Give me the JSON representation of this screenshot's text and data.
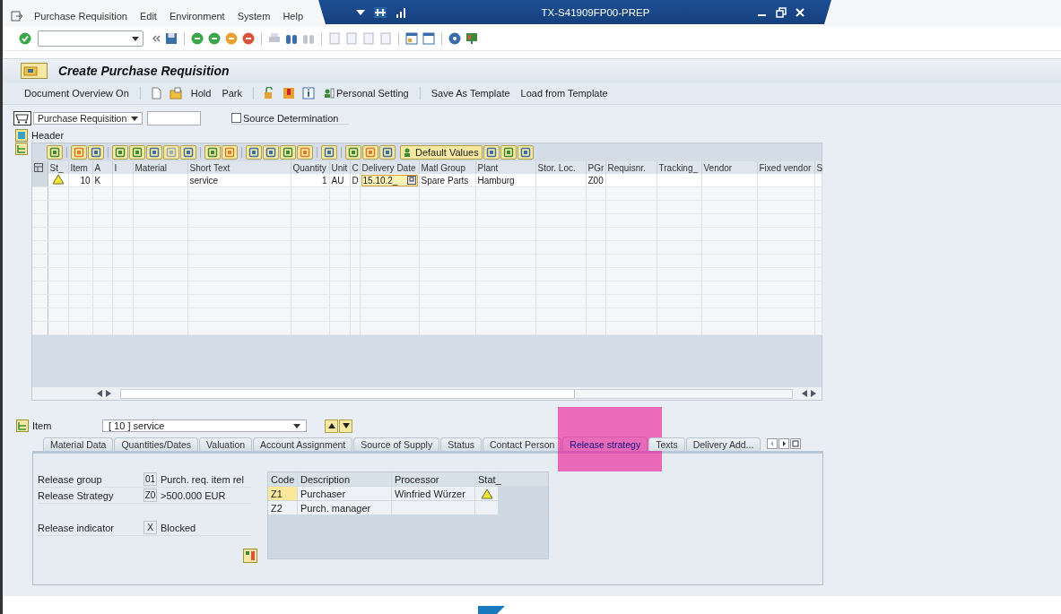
{
  "window": {
    "title": "TX-S41909FP00-PREP"
  },
  "menu": [
    "Purchase Requisition",
    "Edit",
    "Environment",
    "System",
    "Help"
  ],
  "screen_title": "Create Purchase Requisition",
  "app_toolbar": [
    "Document Overview On",
    "Hold",
    "Park",
    "Personal Setting",
    "Save As Template",
    "Load from Template"
  ],
  "document": {
    "type": "Purchase Requisition",
    "source_determination": {
      "label": "Source Determination",
      "checked": false
    }
  },
  "header_label": "Header",
  "grid": {
    "default_values_label": "Default Values",
    "columns": [
      "St_",
      "Item",
      "A",
      "I",
      "Material",
      "Short Text",
      "Quantity",
      "Unit",
      "C",
      "Delivery Date",
      "Matl Group",
      "Plant",
      "Stor. Loc.",
      "PGr",
      "Requisnr.",
      "Tracking_",
      "Vendor",
      "Fixed vendor",
      "S"
    ],
    "rows": [
      {
        "warning": true,
        "cells": [
          null,
          "10",
          "K",
          null,
          null,
          "service",
          "1",
          "AU",
          "D",
          "15.10.2_",
          "Spare Parts",
          "Hamburg",
          null,
          "Z00",
          null,
          null,
          null,
          null,
          null
        ]
      }
    ]
  },
  "item": {
    "label": "Item",
    "value": "[ 10 ] service"
  },
  "tabs": [
    {
      "label": "Material Data",
      "selected": false
    },
    {
      "label": "Quantities/Dates",
      "selected": false
    },
    {
      "label": "Valuation",
      "selected": false
    },
    {
      "label": "Account Assignment",
      "selected": false
    },
    {
      "label": "Source of Supply",
      "selected": false
    },
    {
      "label": "Status",
      "selected": false
    },
    {
      "label": "Contact Person",
      "selected": false
    },
    {
      "label": "Release strategy",
      "selected": true
    },
    {
      "label": "Texts",
      "selected": false
    },
    {
      "label": "Delivery Add...",
      "selected": false
    }
  ],
  "release": {
    "fields": [
      {
        "label": "Release group",
        "code": "01",
        "text": "Purch. req. item rel"
      },
      {
        "label": "Release Strategy",
        "code": "Z0",
        "text": ">500.000 EUR"
      },
      {
        "label": "Release indicator",
        "code": "X",
        "text": "Blocked"
      }
    ],
    "table": {
      "columns": [
        "Code",
        "Description",
        "Processor",
        "Stat_"
      ],
      "rows": [
        {
          "code": "Z1",
          "description": "Purchaser",
          "processor": "Winfried Würzer",
          "warning": true,
          "selected": true
        },
        {
          "code": "Z2",
          "description": "Purch. manager",
          "warning": false,
          "selected": false
        }
      ]
    }
  }
}
